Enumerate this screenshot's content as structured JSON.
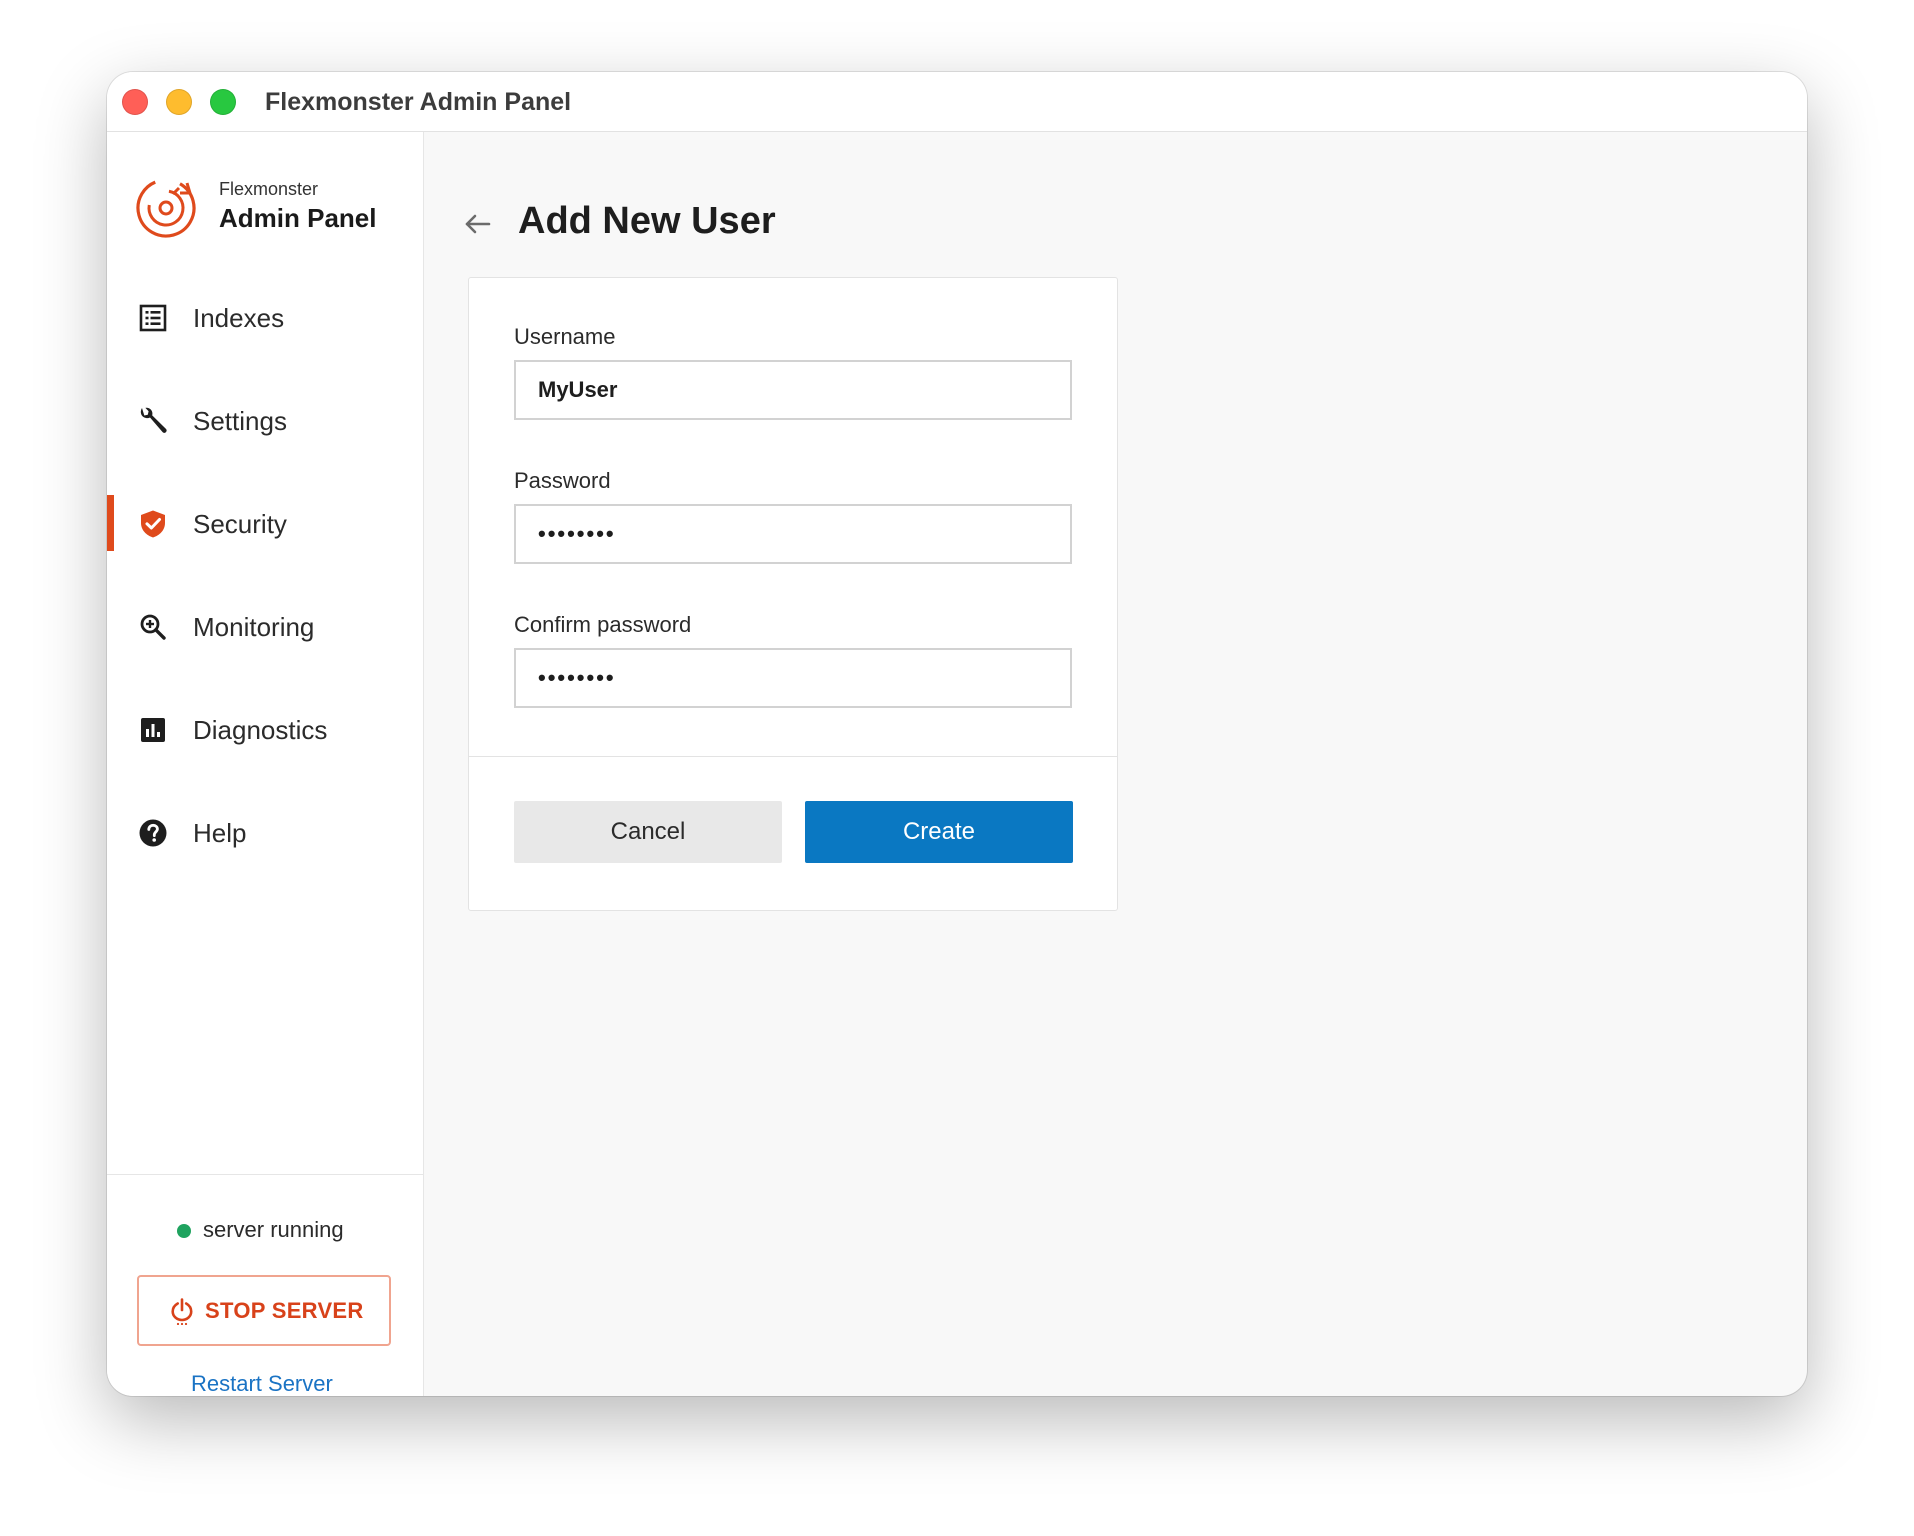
{
  "window": {
    "title": "Flexmonster Admin Panel"
  },
  "brand": {
    "subtitle": "Flexmonster",
    "title": "Admin Panel",
    "logo_icon": "flexmonster-logo-icon",
    "accent_color": "#df4a1c"
  },
  "sidebar": {
    "items": [
      {
        "label": "Indexes",
        "icon": "list-icon",
        "active": false
      },
      {
        "label": "Settings",
        "icon": "wrench-icon",
        "active": false
      },
      {
        "label": "Security",
        "icon": "shield-check-icon",
        "active": true
      },
      {
        "label": "Monitoring",
        "icon": "magnifier-icon",
        "active": false
      },
      {
        "label": "Diagnostics",
        "icon": "bar-chart-icon",
        "active": false
      },
      {
        "label": "Help",
        "icon": "question-circle-icon",
        "active": false
      }
    ],
    "status": {
      "text": "server running",
      "color": "#1fa35f"
    },
    "stop_button": {
      "label": "STOP SERVER",
      "icon": "power-icon"
    },
    "restart_link": "Restart Server"
  },
  "main": {
    "title": "Add New User",
    "back_icon": "arrow-left-icon",
    "form": {
      "username": {
        "label": "Username",
        "value": "MyUser"
      },
      "password": {
        "label": "Password",
        "value": "••••••••"
      },
      "confirm_password": {
        "label": "Confirm password",
        "value": "••••••••"
      }
    },
    "buttons": {
      "cancel": "Cancel",
      "create": "Create",
      "create_color": "#0a78c2"
    }
  }
}
